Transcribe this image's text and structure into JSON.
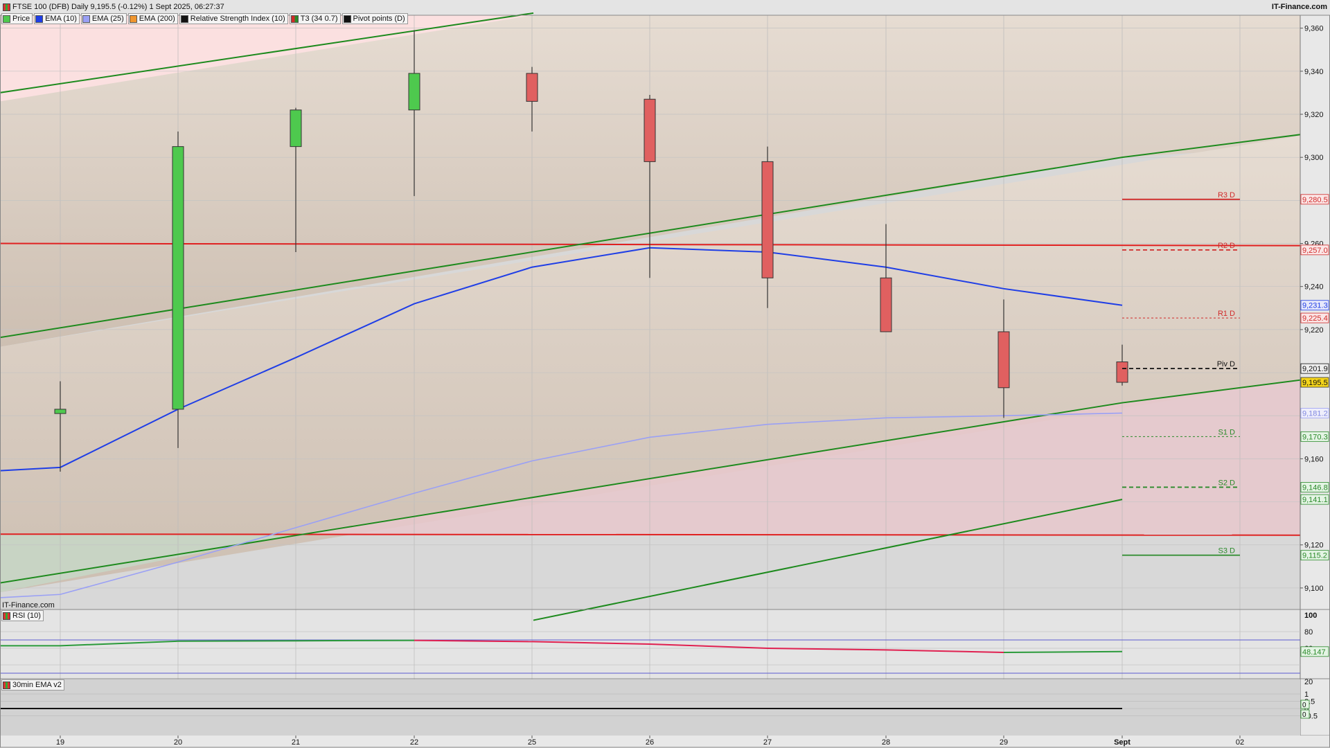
{
  "header": {
    "title": "FTSE 100 (DFB) Daily 9,195.5 (-0.12%) 1 Sept 2025, 06:27:37",
    "brand": "IT-Finance.com",
    "watermark": "IT-Finance.com",
    "logo_icon": "candlestick-logo-icon"
  },
  "legend": [
    {
      "label": "Price",
      "color": "#4ec94e"
    },
    {
      "label": "EMA (10)",
      "color": "#1f3ee6"
    },
    {
      "label": "EMA (25)",
      "color": "#9aa0f5"
    },
    {
      "label": "EMA (200)",
      "color": "#f0962f"
    },
    {
      "label": "Relative Strength Index (10)",
      "color": "#111111"
    },
    {
      "label": "T3 (34 0.7)",
      "color": "#d02a2a"
    },
    {
      "label": "Pivot points (D)",
      "color": "#111111"
    }
  ],
  "panes": {
    "rsi_label": "RSI (10)",
    "ema30_label": "30min EMA v2"
  },
  "chart_data": [
    {
      "type": "candlestick",
      "title": "FTSE 100 (DFB) Daily",
      "x_labels": [
        "19",
        "20",
        "21",
        "22",
        "25",
        "26",
        "27",
        "28",
        "29",
        "Sept",
        "02"
      ],
      "ylim": [
        9090,
        9366
      ],
      "y_ticks": [
        "9,360",
        "9,340",
        "9,320",
        "9,300",
        "9,260",
        "9,240",
        "9,220",
        "9,160",
        "9,120",
        "9,100"
      ],
      "candles": [
        {
          "x": "19",
          "open": 9181,
          "high": 9196,
          "low": 9154,
          "close": 9183
        },
        {
          "x": "20",
          "open": 9183,
          "high": 9312,
          "low": 9165,
          "close": 9305
        },
        {
          "x": "21",
          "open": 9305,
          "high": 9323,
          "low": 9256,
          "close": 9322
        },
        {
          "x": "22",
          "open": 9322,
          "high": 9359,
          "low": 9282,
          "close": 9339
        },
        {
          "x": "25",
          "open": 9339,
          "high": 9342,
          "low": 9312,
          "close": 9326
        },
        {
          "x": "26",
          "open": 9327,
          "high": 9329,
          "low": 9244,
          "close": 9298
        },
        {
          "x": "27",
          "open": 9298,
          "high": 9305,
          "low": 9230,
          "close": 9244
        },
        {
          "x": "28",
          "open": 9244,
          "high": 9269,
          "low": 9222,
          "close": 9219
        },
        {
          "x": "29",
          "open": 9219,
          "high": 9234,
          "low": 9179,
          "close": 9193
        },
        {
          "x": "Sept",
          "open": 9205,
          "high": 9213,
          "low": 9194,
          "close": 9195.5
        }
      ],
      "series": [
        {
          "name": "EMA (10)",
          "color": "#1f3ee6",
          "x": [
            "18",
            "19",
            "20",
            "21",
            "22",
            "25",
            "26",
            "27",
            "28",
            "29",
            "Sept"
          ],
          "values": [
            9153,
            9156,
            9183,
            9207,
            9232,
            9249,
            9258,
            9256,
            9249,
            9239,
            9231.3
          ]
        },
        {
          "name": "EMA (25)",
          "color": "#9aa0f5",
          "x": [
            "18",
            "19",
            "20",
            "21",
            "22",
            "25",
            "26",
            "27",
            "28",
            "29",
            "Sept"
          ],
          "values": [
            9094,
            9097,
            9112,
            9128,
            9144,
            9159,
            9170,
            9176,
            9179,
            9180,
            9181.2
          ]
        }
      ],
      "pivots": [
        {
          "label": "R3 D",
          "value": 9280.5,
          "color": "#d02a2a",
          "style": "solid"
        },
        {
          "label": "R2 D",
          "value": 9257.0,
          "color": "#d02a2a",
          "style": "dashed"
        },
        {
          "label": "R1 D",
          "value": 9225.4,
          "color": "#d02a2a",
          "style": "dotted"
        },
        {
          "label": "Piv D",
          "value": 9201.9,
          "color": "#111111",
          "style": "dashed"
        },
        {
          "label": "S1 D",
          "value": 9170.3,
          "color": "#2a8a2a",
          "style": "dotted"
        },
        {
          "label": "S2 D",
          "value": 9146.8,
          "color": "#2a8a2a",
          "style": "dashed"
        },
        {
          "label": "S3 D",
          "value": 9115.2,
          "color": "#2a8a2a",
          "style": "solid"
        }
      ],
      "horizontal_lines": [
        {
          "value": 9260,
          "color": "#e02020"
        },
        {
          "value": 9125,
          "color": "#e02020"
        }
      ],
      "trend_lines": [
        {
          "x": [
            "18",
            "24"
          ],
          "values": [
            9326,
            9367
          ],
          "color": "#1d8a1d"
        },
        {
          "x": [
            "18",
            "Sept",
            "03"
          ],
          "values": [
            9212,
            9300,
            9314
          ],
          "color": "#1d8a1d"
        },
        {
          "x": [
            "18",
            "Sept",
            "03"
          ],
          "values": [
            9098,
            9186,
            9200
          ],
          "color": "#1d8a1d"
        },
        {
          "x": [
            "24",
            "Sept"
          ],
          "values": [
            9085,
            9141.1
          ],
          "color": "#1d8a1d"
        }
      ],
      "price_tags": [
        {
          "text": "9,280.5",
          "value": 9280.5,
          "kind": "red"
        },
        {
          "text": "9,257.0",
          "value": 9257.0,
          "kind": "red"
        },
        {
          "text": "9,231.3",
          "value": 9231.3,
          "kind": "blue"
        },
        {
          "text": "9,225.4",
          "value": 9225.4,
          "kind": "red"
        },
        {
          "text": "9,201.9",
          "value": 9201.9,
          "kind": "black"
        },
        {
          "text": "9,195.5",
          "value": 9195.5,
          "kind": "yellow"
        },
        {
          "text": "9,181.2",
          "value": 9181.2,
          "kind": "lavender"
        },
        {
          "text": "9,170.3",
          "value": 9170.3,
          "kind": "green"
        },
        {
          "text": "9,146.8",
          "value": 9146.8,
          "kind": "green"
        },
        {
          "text": "9,141.1",
          "value": 9141.1,
          "kind": "green"
        },
        {
          "text": "9,115.2",
          "value": 9115.2,
          "kind": "green"
        }
      ]
    },
    {
      "type": "line",
      "title": "RSI (10)",
      "ylim": [
        0,
        100
      ],
      "y_ticks": [
        "100",
        "80",
        "60",
        "20"
      ],
      "levels": [
        70,
        30
      ],
      "series": [
        {
          "x": [
            "18",
            "19",
            "20",
            "21",
            "22",
            "25",
            "26",
            "27",
            "28",
            "29",
            "Sept"
          ],
          "values": [
            63,
            63,
            68.5,
            69,
            69.5,
            68,
            65,
            60,
            58,
            55,
            56
          ]
        }
      ],
      "last_tag": "48.147"
    },
    {
      "type": "line",
      "title": "30min EMA v2",
      "y_ticks": [
        "1",
        "0.5",
        "0",
        "-0.5"
      ],
      "ylim": [
        -0.8,
        1.4
      ],
      "series": [
        {
          "x": [
            "18",
            "Sept"
          ],
          "values": [
            0,
            0
          ]
        }
      ],
      "tags": [
        "0",
        "0"
      ]
    }
  ]
}
